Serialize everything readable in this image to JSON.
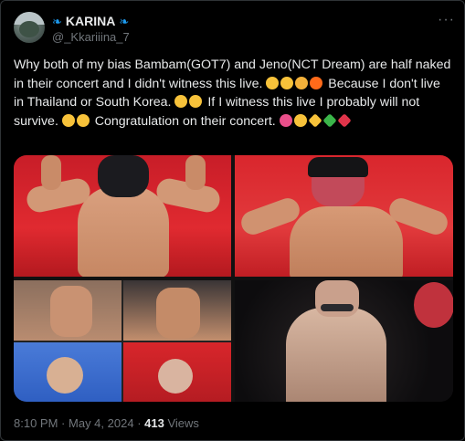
{
  "author": {
    "name": "KARINA",
    "name_prefix_icon": "butterfly-icon",
    "name_suffix_icon": "butterfly-icon",
    "handle": "@_Kkariiina_7"
  },
  "more_icon": "more-options-icon",
  "tweet": {
    "segments": [
      {
        "type": "text",
        "value": "Why both of my bias Bambam(GOT7) and Jeno(NCT Dream) are half naked in their concert and I didn't witness this live. "
      },
      {
        "type": "emoji",
        "name": "shushing-face-emoji",
        "color": "#f7c23a"
      },
      {
        "type": "emoji",
        "name": "astonished-face-emoji",
        "color": "#f7c23a"
      },
      {
        "type": "emoji",
        "name": "flexed-biceps-emoji",
        "color": "#f3b13a"
      },
      {
        "type": "emoji",
        "name": "fire-emoji",
        "color": "#ff6a1a"
      },
      {
        "type": "text",
        "value": " Because I don't live in Thailand or South Korea. "
      },
      {
        "type": "emoji",
        "name": "pleading-face-emoji",
        "color": "#f7c23a"
      },
      {
        "type": "emoji",
        "name": "crying-face-emoji",
        "color": "#f7c23a"
      },
      {
        "type": "text",
        "value": " If I witness this live I probably will not survive. "
      },
      {
        "type": "emoji",
        "name": "tears-of-joy-emoji",
        "color": "#f7c23a"
      },
      {
        "type": "emoji",
        "name": "grinning-face-emoji",
        "color": "#f7c23a"
      },
      {
        "type": "text",
        "value": " Congratulation on their concert. "
      },
      {
        "type": "emoji",
        "name": "party-popper-emoji",
        "color": "#e94f8a"
      },
      {
        "type": "emoji",
        "name": "partying-face-emoji",
        "color": "#f7c23a"
      },
      {
        "type": "emoji",
        "name": "smiling-hearts-emoji",
        "color": "#f7c23a"
      },
      {
        "type": "emoji",
        "name": "green-heart-emoji",
        "color": "#3bb54a"
      },
      {
        "type": "emoji",
        "name": "red-heart-emoji",
        "color": "#e0344a"
      }
    ]
  },
  "media": {
    "photos": [
      {
        "name": "photo-bambam-flex-red-background"
      },
      {
        "name": "photo-jeno-back-flex-red-background"
      },
      {
        "name": "photo-bambam-collage"
      },
      {
        "name": "photo-jeno-dark-stage"
      }
    ]
  },
  "meta": {
    "time": "8:10 PM",
    "sep1": "·",
    "date": "May 4, 2024",
    "sep2": "·",
    "views_count": "413",
    "views_label": "Views"
  },
  "colors": {
    "background": "#000000",
    "text": "#e7e9ea",
    "secondary": "#71767b",
    "accent": "#1d9bf0"
  }
}
